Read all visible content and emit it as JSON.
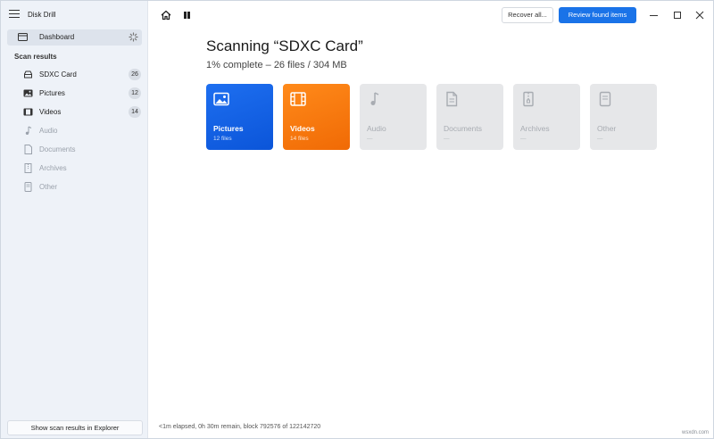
{
  "app": {
    "title": "Disk Drill"
  },
  "sidebar": {
    "dashboard_label": "Dashboard",
    "section_label": "Scan results",
    "items": [
      {
        "label": "SDXC Card",
        "count": "26",
        "icon": "drive-icon",
        "enabled": true
      },
      {
        "label": "Pictures",
        "count": "12",
        "icon": "picture-icon",
        "enabled": true
      },
      {
        "label": "Videos",
        "count": "14",
        "icon": "video-icon",
        "enabled": true
      },
      {
        "label": "Audio",
        "icon": "music-note-icon",
        "enabled": false
      },
      {
        "label": "Documents",
        "icon": "document-icon",
        "enabled": false
      },
      {
        "label": "Archives",
        "icon": "archive-icon",
        "enabled": false
      },
      {
        "label": "Other",
        "icon": "file-icon",
        "enabled": false
      }
    ],
    "explorer_button": "Show scan results in Explorer"
  },
  "toolbar": {
    "recover_label": "Recover all...",
    "review_label": "Review found items"
  },
  "main": {
    "title": "Scanning “SDXC Card”",
    "subtitle": "1% complete – 26 files / 304 MB",
    "progress_percent": 1,
    "cards": [
      {
        "title": "Pictures",
        "sub": "12 files",
        "icon": "picture-icon",
        "style": "active-blue"
      },
      {
        "title": "Videos",
        "sub": "14 files",
        "icon": "film-icon",
        "style": "active-orange"
      },
      {
        "title": "Audio",
        "sub": "—",
        "icon": "music-note-icon",
        "style": "inactive"
      },
      {
        "title": "Documents",
        "sub": "—",
        "icon": "document-icon",
        "style": "inactive"
      },
      {
        "title": "Archives",
        "sub": "—",
        "icon": "archive-icon",
        "style": "inactive"
      },
      {
        "title": "Other",
        "sub": "—",
        "icon": "file-icon",
        "style": "inactive"
      }
    ]
  },
  "status": {
    "text": "<1m elapsed, 0h 30m remain, block 792576 of 122142720"
  },
  "watermark": "wsxdn.com",
  "colors": {
    "accent": "#1a73e8",
    "pictures": "#1e6ff0",
    "videos": "#ff8a1a",
    "sidebar_bg": "#eef2f8"
  }
}
